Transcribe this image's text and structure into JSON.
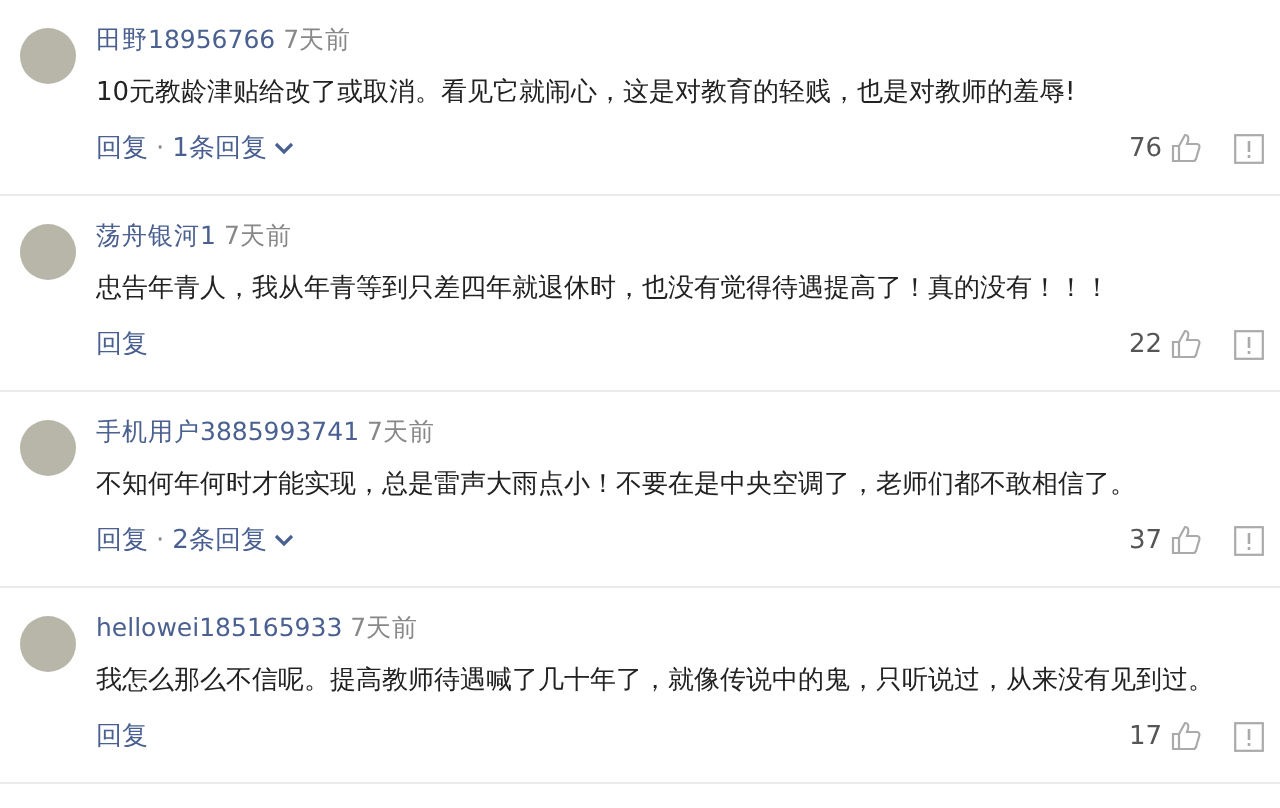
{
  "comments": [
    {
      "user": "田野18956766",
      "time": "7天前",
      "text": "10元教龄津贴给改了或取消。看见它就闹心，这是对教育的轻贱，也是对教师的羞辱!",
      "reply_label": "回复",
      "separator": "·",
      "replies": "1条回复",
      "likes": "76"
    },
    {
      "user": "荡舟银河1",
      "time": "7天前",
      "text": "忠告年青人，我从年青等到只差四年就退休时，也没有觉得待遇提高了！真的没有！！！",
      "reply_label": "回复",
      "likes": "22"
    },
    {
      "user": "手机用户3885993741",
      "time": "7天前",
      "text": "不知何年何时才能实现，总是雷声大雨点小！不要在是中央空调了，老师们都不敢相信了。",
      "reply_label": "回复",
      "separator": "·",
      "replies": "2条回复",
      "likes": "37"
    },
    {
      "user": "hellowei185165933",
      "time": "7天前",
      "text": "我怎么那么不信呢。提高教师待遇喊了几十年了，就像传说中的鬼，只听说过，从来没有见到过。",
      "reply_label": "回复",
      "likes": "17"
    }
  ]
}
